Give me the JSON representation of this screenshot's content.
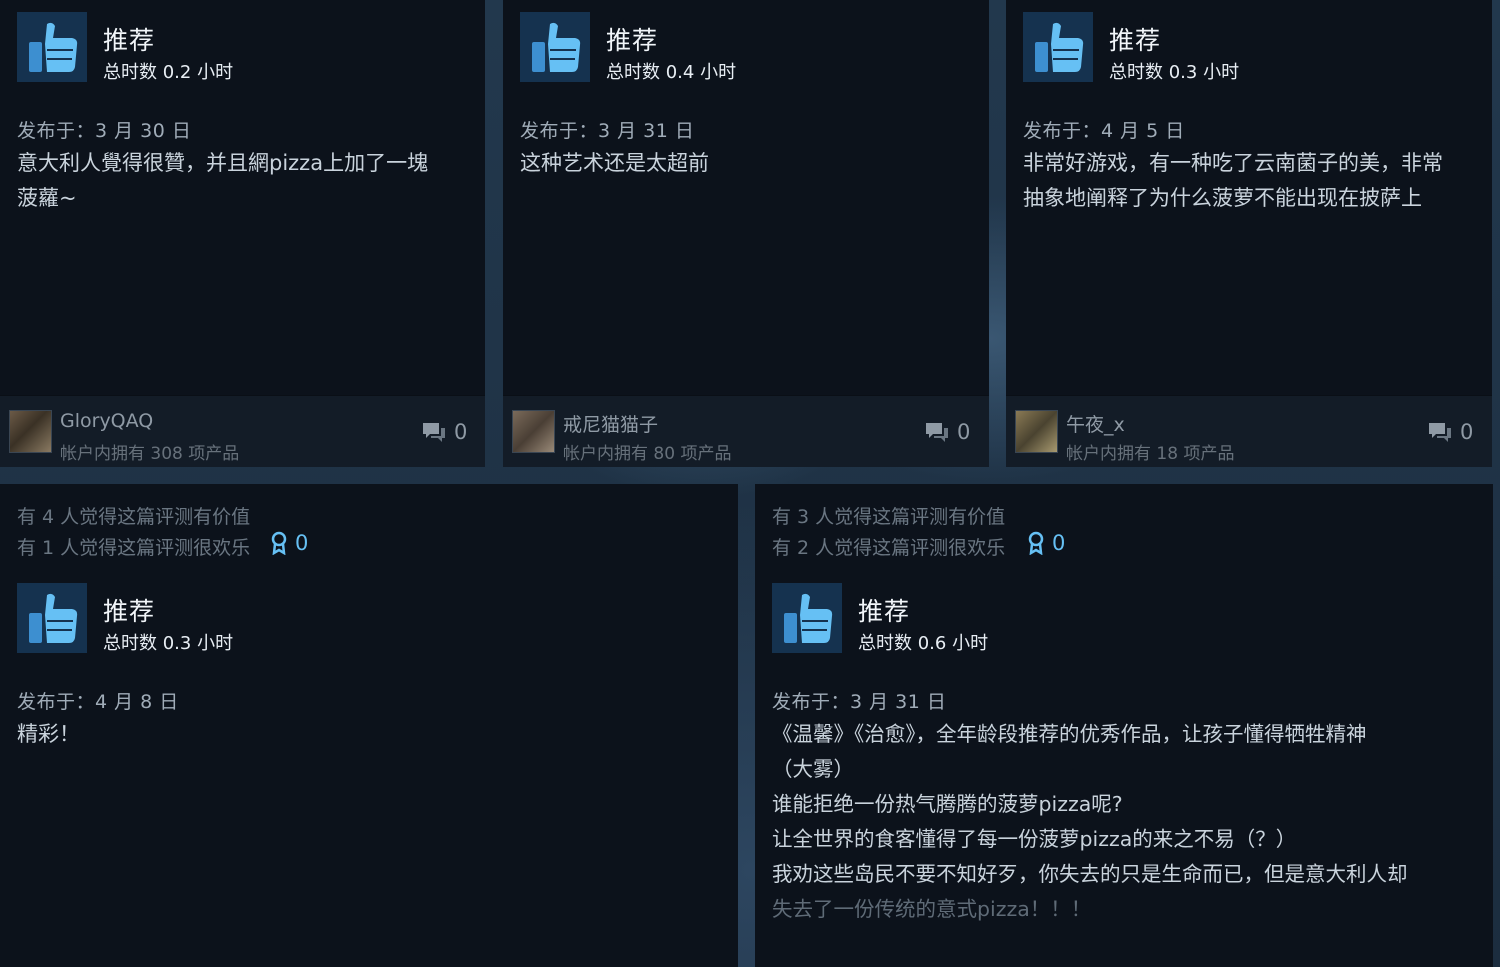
{
  "reviews_top": [
    {
      "recommend": "推荐",
      "hours": "总时数 0.2 小时",
      "posted": "发布于：3 月 30 日",
      "body": [
        "意大利人覺得很贊，并且網pizza上加了一塊",
        "菠蘿~"
      ],
      "author": "GloryQAQ",
      "owned": "帐户内拥有 308 项产品",
      "comments": "0"
    },
    {
      "recommend": "推荐",
      "hours": "总时数 0.4 小时",
      "posted": "发布于：3 月 31 日",
      "body": [
        "这种艺术还是太超前"
      ],
      "author": "戒尼猫猫子",
      "owned": "帐户内拥有 80 项产品",
      "comments": "0"
    },
    {
      "recommend": "推荐",
      "hours": "总时数 0.3 小时",
      "posted": "发布于：4 月 5 日",
      "body": [
        "非常好游戏，有一种吃了云南菌子的美，非常",
        "抽象地阐释了为什么菠萝不能出现在披萨上"
      ],
      "author": "午夜_x",
      "owned": "帐户内拥有 18 项产品",
      "comments": "0"
    }
  ],
  "reviews_bottom": [
    {
      "helpful": "有 4 人觉得这篇评测有价值",
      "funny": "有 1 人觉得这篇评测很欢乐",
      "awards": "0",
      "recommend": "推荐",
      "hours": "总时数 0.3 小时",
      "posted": "发布于：4 月 8 日",
      "body": [
        "精彩！"
      ]
    },
    {
      "helpful": "有 3 人觉得这篇评测有价值",
      "funny": "有 2 人觉得这篇评测很欢乐",
      "awards": "0",
      "recommend": "推荐",
      "hours": "总时数 0.6 小时",
      "posted": "发布于：3 月 31 日",
      "body": [
        "《温馨》《治愈》，全年龄段推荐的优秀作品，让孩子懂得牺牲精神",
        "（大雾）",
        "谁能拒绝一份热气腾腾的菠萝pizza呢?",
        "让全世界的食客懂得了每一份菠萝pizza的来之不易（？）",
        "我劝这些岛民不要不知好歹，你失去的只是生命而已，但是意大利人却",
        "失去了一份传统的意式pizza！！！"
      ]
    }
  ],
  "icons": {
    "thumb": "thumbs-up-icon",
    "comment": "comment-bubble-icon",
    "award": "award-ribbon-icon"
  },
  "colors": {
    "card_bg": "#0c121b",
    "thumb_bg": "#15324f",
    "thumb_fg": "#66c0f4",
    "award": "#66c0f4"
  }
}
